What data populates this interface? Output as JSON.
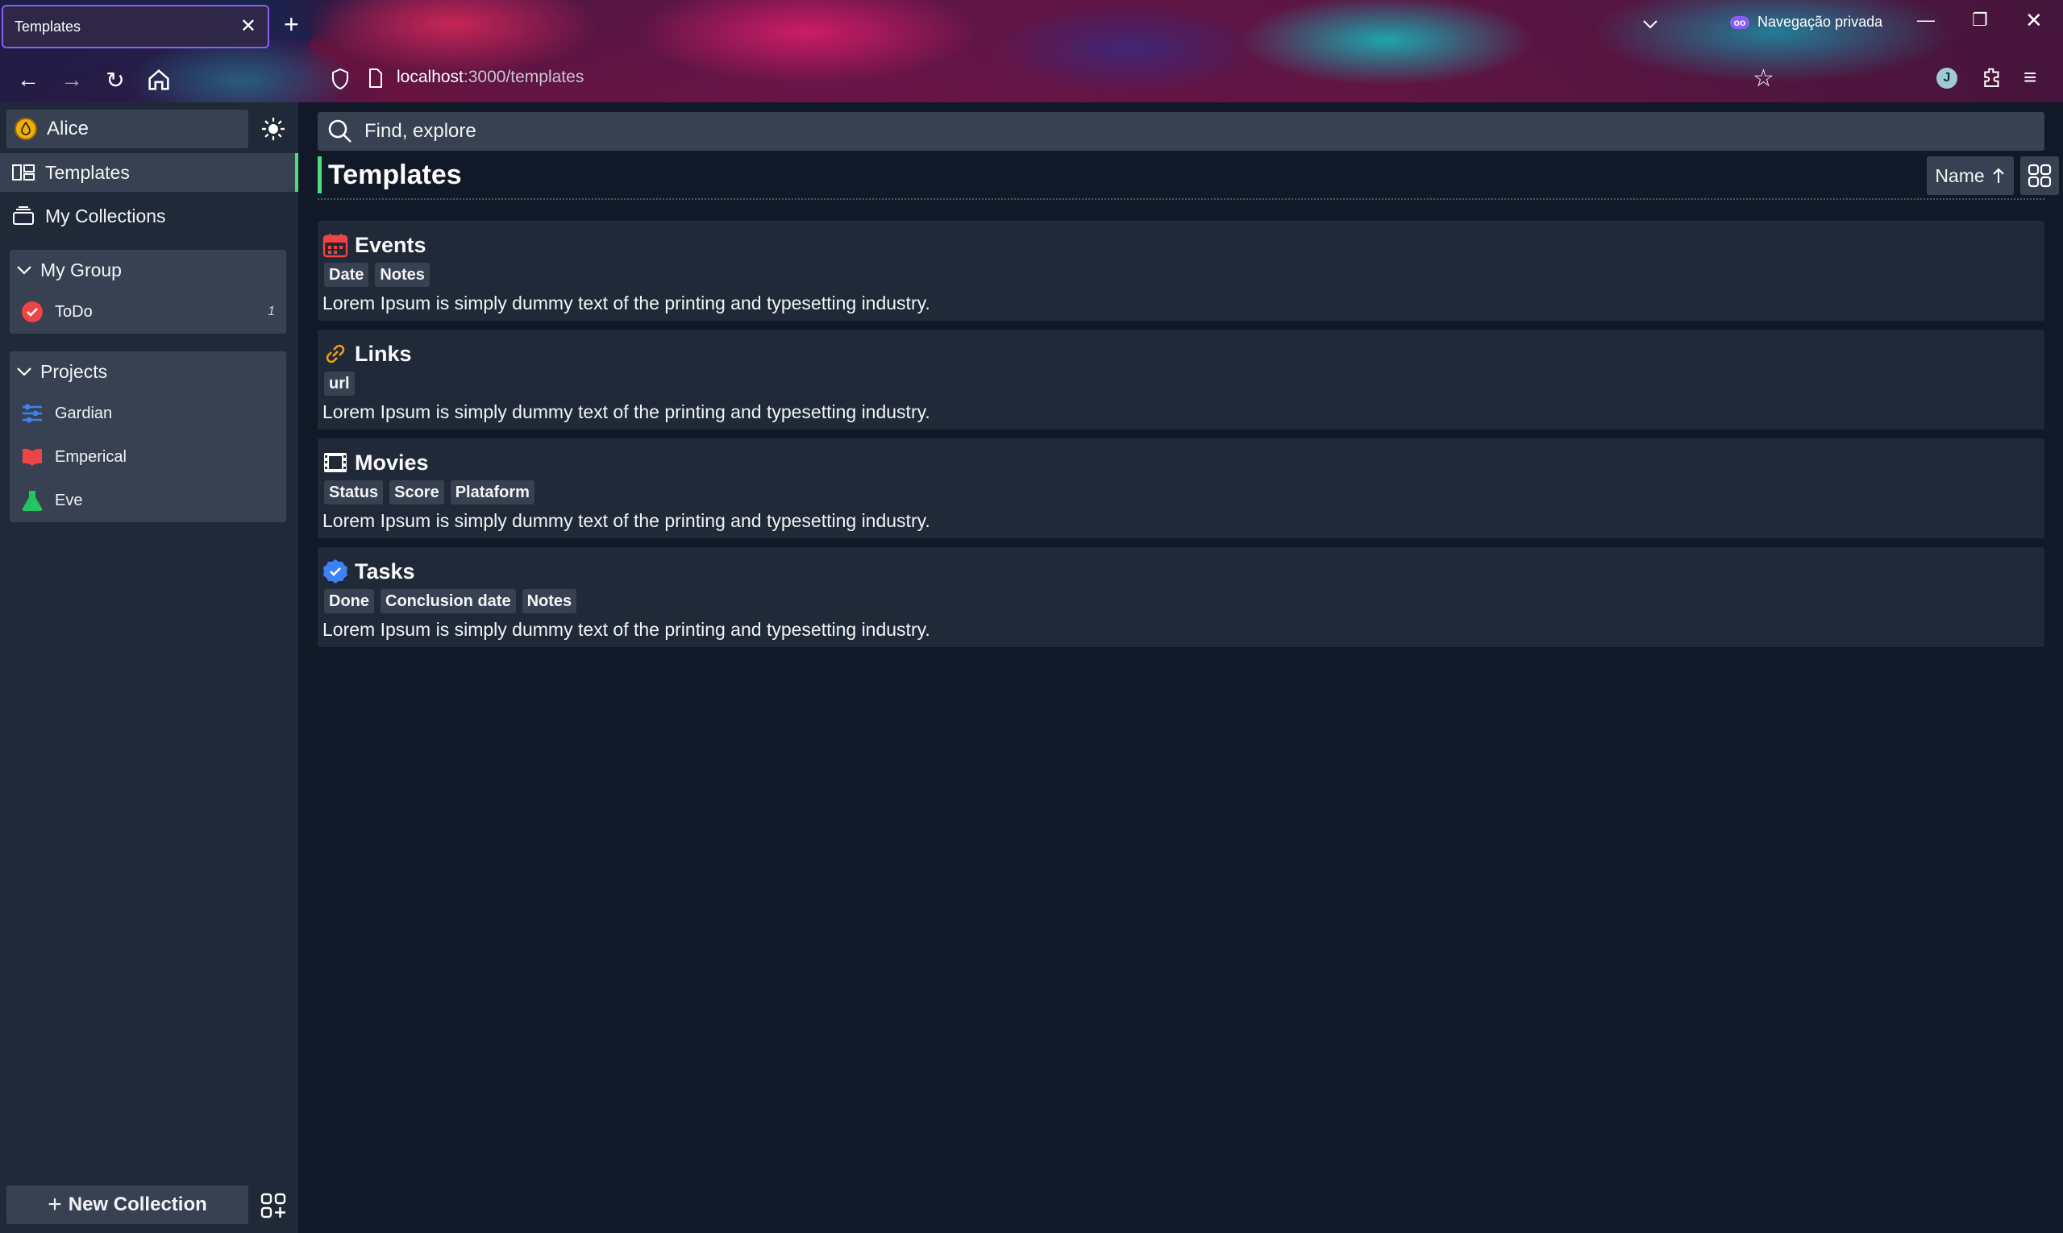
{
  "browser": {
    "tab_title": "Templates",
    "url_host": "localhost",
    "url_path": ":3000/templates",
    "private_label": "Navegação privada",
    "avatar_letter": "J"
  },
  "sidebar": {
    "user": "Alice",
    "nav": [
      {
        "label": "Templates",
        "icon": "templates-icon",
        "active": true
      },
      {
        "label": "My Collections",
        "icon": "collections-icon",
        "active": false
      }
    ],
    "groups": [
      {
        "title": "My Group",
        "items": [
          {
            "label": "ToDo",
            "icon": "check-circle-icon",
            "count": "1"
          }
        ]
      },
      {
        "title": "Projects",
        "items": [
          {
            "label": "Gardian",
            "icon": "sliders-icon"
          },
          {
            "label": "Emperical",
            "icon": "book-icon"
          },
          {
            "label": "Eve",
            "icon": "flask-icon"
          }
        ]
      }
    ],
    "new_collection": "New Collection"
  },
  "main": {
    "search_placeholder": "Find, explore",
    "title": "Templates",
    "sort_label": "Name",
    "templates": [
      {
        "name": "Events",
        "icon": "calendar-icon",
        "tags": [
          "Date",
          "Notes"
        ],
        "desc": "Lorem Ipsum is simply dummy text of the printing and typesetting industry."
      },
      {
        "name": "Links",
        "icon": "link-icon",
        "tags": [
          "url"
        ],
        "desc": "Lorem Ipsum is simply dummy text of the printing and typesetting industry."
      },
      {
        "name": "Movies",
        "icon": "film-icon",
        "tags": [
          "Status",
          "Score",
          "Plataform"
        ],
        "desc": "Lorem Ipsum is simply dummy text of the printing and typesetting industry."
      },
      {
        "name": "Tasks",
        "icon": "check-badge-icon",
        "tags": [
          "Done",
          "Conclusion date",
          "Notes"
        ],
        "desc": "Lorem Ipsum is simply dummy text of the printing and typesetting industry."
      }
    ]
  },
  "colors": {
    "accent": "#4ade80",
    "sidebar_bg": "#1f2937",
    "main_bg": "#111827",
    "control_bg": "#374151"
  }
}
